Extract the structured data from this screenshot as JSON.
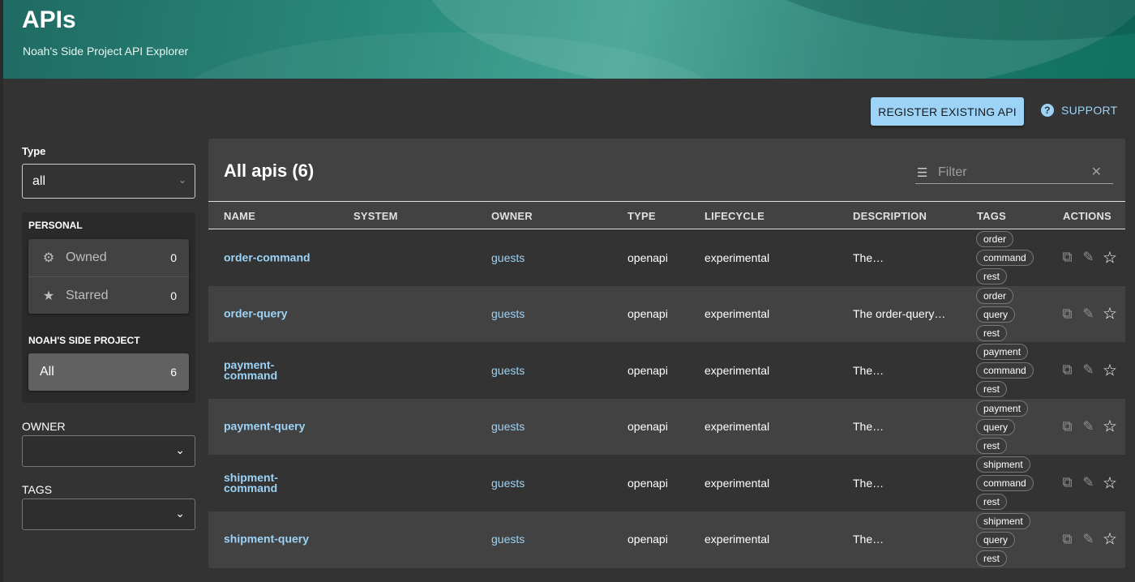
{
  "header": {
    "title": "APIs",
    "subtitle": "Noah's Side Project API Explorer"
  },
  "actions": {
    "register_label": "REGISTER EXISTING API",
    "support_label": "SUPPORT"
  },
  "sidebar": {
    "type_label": "Type",
    "type_value": "all",
    "personal_title": "PERSONAL",
    "personal_items": [
      {
        "label": "Owned",
        "count": "0",
        "icon": "gear-icon"
      },
      {
        "label": "Starred",
        "count": "0",
        "icon": "star-icon"
      }
    ],
    "org_title": "NOAH'S SIDE PROJECT",
    "org_items": [
      {
        "label": "All",
        "count": "6"
      }
    ],
    "owner_label": "OWNER",
    "tags_label": "TAGS"
  },
  "table": {
    "title": "All apis (6)",
    "filter_placeholder": "Filter",
    "columns": [
      "NAME",
      "SYSTEM",
      "OWNER",
      "TYPE",
      "LIFECYCLE",
      "DESCRIPTION",
      "TAGS",
      "ACTIONS"
    ],
    "rows": [
      {
        "name": "order-command",
        "system": "",
        "owner": "guests",
        "type": "openapi",
        "lifecycle": "experimental",
        "description": "The…",
        "tags": [
          "order",
          "command",
          "rest"
        ]
      },
      {
        "name": "order-query",
        "system": "",
        "owner": "guests",
        "type": "openapi",
        "lifecycle": "experimental",
        "description": "The order-query…",
        "tags": [
          "order",
          "query",
          "rest"
        ]
      },
      {
        "name": "payment-command",
        "system": "",
        "owner": "guests",
        "type": "openapi",
        "lifecycle": "experimental",
        "description": "The…",
        "tags": [
          "payment",
          "command",
          "rest"
        ]
      },
      {
        "name": "payment-query",
        "system": "",
        "owner": "guests",
        "type": "openapi",
        "lifecycle": "experimental",
        "description": "The…",
        "tags": [
          "payment",
          "query",
          "rest"
        ]
      },
      {
        "name": "shipment-command",
        "system": "",
        "owner": "guests",
        "type": "openapi",
        "lifecycle": "experimental",
        "description": "The…",
        "tags": [
          "shipment",
          "command",
          "rest"
        ]
      },
      {
        "name": "shipment-query",
        "system": "",
        "owner": "guests",
        "type": "openapi",
        "lifecycle": "experimental",
        "description": "The…",
        "tags": [
          "shipment",
          "query",
          "rest"
        ]
      }
    ]
  },
  "colors": {
    "accent": "#9cd3f7",
    "header_teal": "#2a8b7c",
    "background": "#333333",
    "card": "#424242"
  }
}
